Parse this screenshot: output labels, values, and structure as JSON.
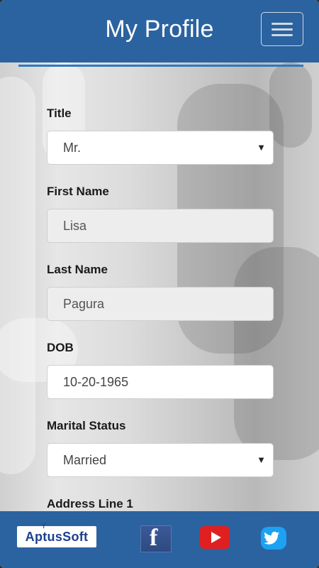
{
  "header": {
    "title": "My Profile",
    "menu_icon": "hamburger-icon"
  },
  "form": {
    "title": {
      "label": "Title",
      "value": "Mr."
    },
    "first_name": {
      "label": "First Name",
      "value": "Lisa"
    },
    "last_name": {
      "label": "Last Name",
      "value": "Pagura"
    },
    "dob": {
      "label": "DOB",
      "value": "10-20-1965"
    },
    "marital_status": {
      "label": "Marital Status",
      "value": "Married"
    },
    "address_line_1": {
      "label": "Address Line 1"
    },
    "select_caret": "▼"
  },
  "footer": {
    "logo_text": "AptusSoft",
    "facebook_glyph": "f",
    "icons": [
      "aptussoft-logo",
      "facebook-icon",
      "youtube-icon",
      "twitter-icon"
    ]
  },
  "colors": {
    "primary": "#2b63a0",
    "accent_rule": "#2f78c4",
    "youtube_red": "#e02020",
    "twitter_blue": "#1da1f2",
    "facebook_blue": "#3b5998"
  }
}
